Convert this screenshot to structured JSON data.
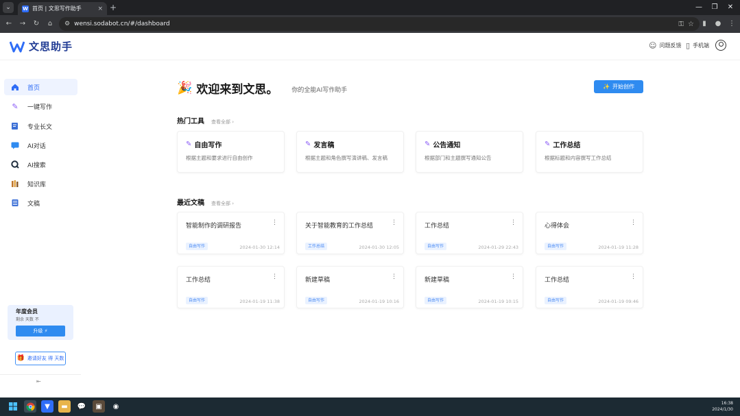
{
  "browser": {
    "tab_title": "首页 | 文思写作助手",
    "tab_close": "×",
    "new_tab": "+",
    "url": "wensi.sodabot.cn/#/dashboard",
    "colors": {
      "frame": "#202124",
      "toolbar": "#35363a"
    }
  },
  "header": {
    "logo_text": "文思助手",
    "feedback_label": "问题反馈",
    "mobile_label": "手机端"
  },
  "sidebar": {
    "items": [
      {
        "label": "首页",
        "icon": "home-icon",
        "active": true
      },
      {
        "label": "一键写作",
        "icon": "pen-icon",
        "active": false
      },
      {
        "label": "专业长文",
        "icon": "document-edit-icon",
        "active": false
      },
      {
        "label": "AI对话",
        "icon": "chat-icon",
        "active": false
      },
      {
        "label": "AI搜索",
        "icon": "search-icon",
        "active": false
      },
      {
        "label": "知识库",
        "icon": "library-icon",
        "active": false
      },
      {
        "label": "文稿",
        "icon": "file-list-icon",
        "active": false
      }
    ],
    "member": {
      "title": "年度会员",
      "subtitle": "剩余 天数 不",
      "upgrade_label": "升级 ⚡"
    },
    "invite_label": "邀请好友 得 天数",
    "collapse_label": "⇤"
  },
  "main": {
    "welcome_title": "欢迎来到文思。",
    "welcome_subtitle": "你的全能AI写作助手",
    "start_button": "开始创作",
    "hot_tools": {
      "title": "热门工具",
      "see_all": "查看全部 ›",
      "items": [
        {
          "name": "自由写作",
          "desc": "根据主题和要求进行自由创作"
        },
        {
          "name": "发言稿",
          "desc": "根据主题和角色撰写演讲稿、发言稿"
        },
        {
          "name": "公告通知",
          "desc": "根据部门和主题撰写通知公告"
        },
        {
          "name": "工作总结",
          "desc": "根据标题和内容撰写工作总结"
        }
      ]
    },
    "recent_docs": {
      "title": "最近文稿",
      "see_all": "查看全部 ›",
      "more": "⋮",
      "items": [
        {
          "title": "智能制作的调研报告",
          "tag": "自由写作",
          "date": "2024-01-30 12:14"
        },
        {
          "title": "关于智能教育的工作总结",
          "tag": "工作总结",
          "date": "2024-01-30 12:05"
        },
        {
          "title": "工作总结",
          "tag": "自由写作",
          "date": "2024-01-29 22:43"
        },
        {
          "title": "心得体会",
          "tag": "自由写作",
          "date": "2024-01-19 11:28"
        },
        {
          "title": "工作总结",
          "tag": "自由写作",
          "date": "2024-01-19 11:38"
        },
        {
          "title": "新建草稿",
          "tag": "自由写作",
          "date": "2024-01-19 10:16"
        },
        {
          "title": "新建草稿",
          "tag": "自由写作",
          "date": "2024-01-19 10:15"
        },
        {
          "title": "工作总结",
          "tag": "自由写作",
          "date": "2024-01-19 09:46"
        }
      ]
    }
  },
  "taskbar": {
    "time": "16:38",
    "date": "2024/1/30"
  },
  "colors": {
    "accent": "#2f8bf0",
    "active_bg": "#eef3ff",
    "tag_bg": "#eaf2ff",
    "taskbar": "#1c2a33"
  }
}
